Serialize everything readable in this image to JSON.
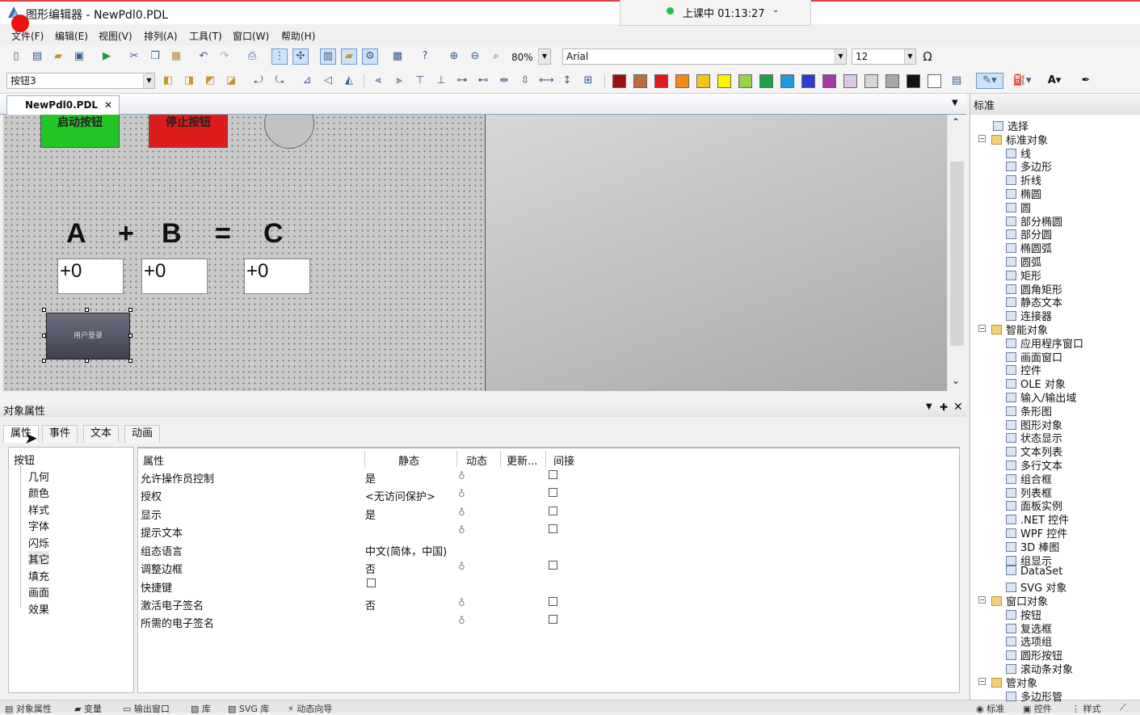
{
  "title": "图形编辑器 - NewPdl0.PDL",
  "class_timer": "上课中 01:13:27",
  "menu": [
    "文件(F)",
    "编辑(E)",
    "视图(V)",
    "排列(A)",
    "工具(T)",
    "窗口(W)",
    "帮助(H)"
  ],
  "toolbar": {
    "zoom": "80%",
    "font": "Arial",
    "font_size": "12",
    "omega": "Ω",
    "object_selector": "按钮3"
  },
  "palette": [
    "#9b1010",
    "#b8703a",
    "#e01a1a",
    "#f08a18",
    "#f5c518",
    "#fff200",
    "#9ad14a",
    "#1ea245",
    "#1e9be0",
    "#2c3cd0",
    "#a23aa8",
    "#d8c8e6",
    "#d6d6d6",
    "#a8a8a8",
    "#111111",
    "#ffffff"
  ],
  "doc_tab": {
    "label": "NewPdl0.PDL",
    "close": "✕"
  },
  "canvas": {
    "start_button": "启动按钮",
    "stop_button": "停止按钮",
    "eq_a": "A",
    "eq_plus": "+",
    "eq_b": "B",
    "eq_equals": "=",
    "eq_c": "C",
    "io_a": "+0",
    "io_b": "+0",
    "io_c": "+0",
    "login_button": "用户登录"
  },
  "props_panel": {
    "title": "对象属性",
    "tabs": [
      "属性",
      "事件",
      "文本",
      "动画"
    ],
    "tree": [
      "按钮",
      "几何",
      "颜色",
      "样式",
      "字体",
      "闪烁",
      "其它",
      "填充",
      "画面",
      "效果"
    ],
    "columns": [
      "属性",
      "静态",
      "动态",
      "更新...",
      "间接"
    ],
    "rows": [
      {
        "name": "允许操作员控制",
        "static": "是"
      },
      {
        "name": "授权",
        "static": "<无访问保护>"
      },
      {
        "name": "显示",
        "static": "是"
      },
      {
        "name": "提示文本",
        "static": ""
      },
      {
        "name": "组态语言",
        "static": "中文(简体，中国)"
      },
      {
        "name": "调整边框",
        "static": "否"
      },
      {
        "name": "快捷键",
        "static": ""
      },
      {
        "name": "激活电子签名",
        "static": "否"
      },
      {
        "name": "所需的电子签名",
        "static": ""
      }
    ]
  },
  "status_tabs": [
    "对象属性",
    "变量",
    "输出窗口",
    "库",
    "SVG 库",
    "动态向导"
  ],
  "right_panel": {
    "title": "标准",
    "select": "选择",
    "group_standard": "标准对象",
    "standard": [
      "线",
      "多边形",
      "折线",
      "椭圆",
      "圆",
      "部分椭圆",
      "部分圆",
      "椭圆弧",
      "圆弧",
      "矩形",
      "圆角矩形",
      "静态文本",
      "连接器"
    ],
    "group_smart": "智能对象",
    "smart": [
      "应用程序窗口",
      "画面窗口",
      "控件",
      "OLE 对象",
      "输入/输出域",
      "条形图",
      "图形对象",
      "状态显示",
      "文本列表",
      "多行文本",
      "组合框",
      "列表框",
      "面板实例",
      ".NET 控件",
      "WPF 控件",
      "3D 棒图",
      "组显示",
      "DataSet",
      "SVG 对象"
    ],
    "group_window": "窗口对象",
    "window": [
      "按钮",
      "复选框",
      "选项组",
      "圆形按钮",
      "滚动条对象"
    ],
    "group_pipe": "管对象",
    "pipe": [
      "多边形管"
    ],
    "bottom_tabs": [
      "标准",
      "控件",
      "样式"
    ]
  }
}
